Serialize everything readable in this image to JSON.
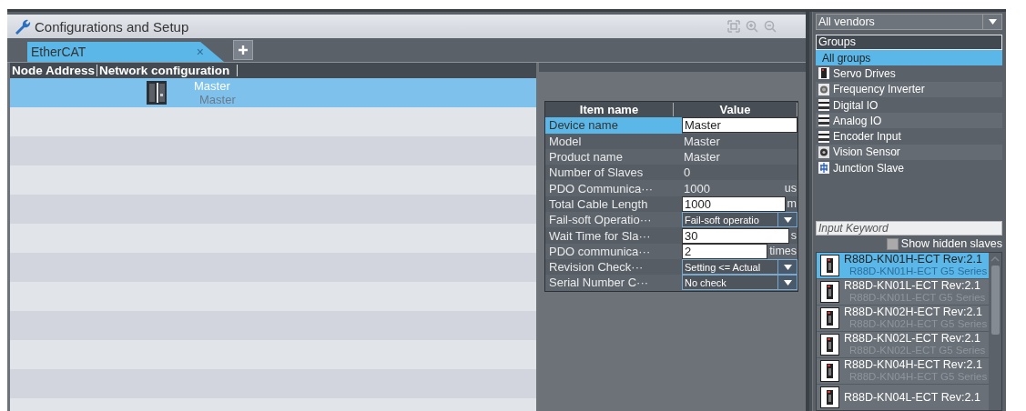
{
  "window": {
    "title": "Configurations and Setup"
  },
  "tabs": [
    {
      "label": "EtherCAT",
      "selected": true,
      "close": "×"
    }
  ],
  "network": {
    "columns": [
      "Node Address",
      "Network configuration"
    ],
    "rows": [
      {
        "name": "Master",
        "model": "Master",
        "selected": true
      }
    ]
  },
  "properties": {
    "columns": [
      "Item name",
      "Value"
    ],
    "rows": [
      {
        "kind": "input",
        "name": "Device name",
        "value": "Master",
        "selected": true
      },
      {
        "kind": "text",
        "name": "Model",
        "value": "Master",
        "selected": false
      },
      {
        "kind": "text",
        "name": "Product name",
        "value": "Master",
        "selected": false
      },
      {
        "kind": "text",
        "name": "Number of Slaves",
        "value": "0",
        "selected": false
      },
      {
        "kind": "text",
        "name": "PDO Communica···",
        "value": "1000",
        "unit": "us",
        "selected": false
      },
      {
        "kind": "input",
        "name": "Total Cable Length",
        "value": "1000",
        "unit": "m",
        "selected": false
      },
      {
        "kind": "select",
        "name": "Fail-soft Operatio···",
        "value": "Fail-soft operatio",
        "selected": false
      },
      {
        "kind": "input",
        "name": "Wait Time for Sla···",
        "value": "30",
        "unit": "s",
        "selected": false
      },
      {
        "kind": "input",
        "name": "PDO communica···",
        "value": "2",
        "unit": "times",
        "selected": false
      },
      {
        "kind": "select",
        "name": "Revision Check···",
        "value": "Setting <= Actual",
        "selected": false
      },
      {
        "kind": "select",
        "name": "Serial Number C···",
        "value": "No check",
        "selected": false
      }
    ]
  },
  "toolbox": {
    "vendor": "All vendors",
    "groups_label": "Groups",
    "groups": [
      {
        "label": "All groups",
        "kind": "none",
        "selected": true
      },
      {
        "label": "Servo Drives",
        "kind": "servo",
        "selected": false
      },
      {
        "label": "Frequency Inverter",
        "kind": "inverter",
        "selected": false
      },
      {
        "label": "Digital IO",
        "kind": "io",
        "selected": false
      },
      {
        "label": "Analog IO",
        "kind": "io",
        "selected": false
      },
      {
        "label": "Encoder Input",
        "kind": "io",
        "selected": false
      },
      {
        "label": "Vision Sensor",
        "kind": "camera",
        "selected": false
      },
      {
        "label": "Junction Slave",
        "kind": "junction",
        "selected": false
      }
    ],
    "keyword": {
      "placeholder": "Input Keyword"
    },
    "show_hidden": {
      "label": "Show hidden slaves",
      "checked": false
    },
    "devices": [
      {
        "name": "R88D-KN01H-ECT Rev:2.1",
        "description": "R88D-KN01H-ECT G5 Series",
        "selected": true
      },
      {
        "name": "R88D-KN01L-ECT Rev:2.1",
        "description": "R88D-KN01L-ECT G5 Series",
        "selected": false
      },
      {
        "name": "R88D-KN02H-ECT Rev:2.1",
        "description": "R88D-KN02H-ECT G5 Series",
        "selected": false
      },
      {
        "name": "R88D-KN02L-ECT Rev:2.1",
        "description": "R88D-KN02L-ECT G5 Series",
        "selected": false
      },
      {
        "name": "R88D-KN04H-ECT Rev:2.1",
        "description": "R88D-KN04H-ECT G5 Series",
        "selected": false
      },
      {
        "name": "R88D-KN04L-ECT Rev:2.1",
        "selected": false
      }
    ]
  }
}
